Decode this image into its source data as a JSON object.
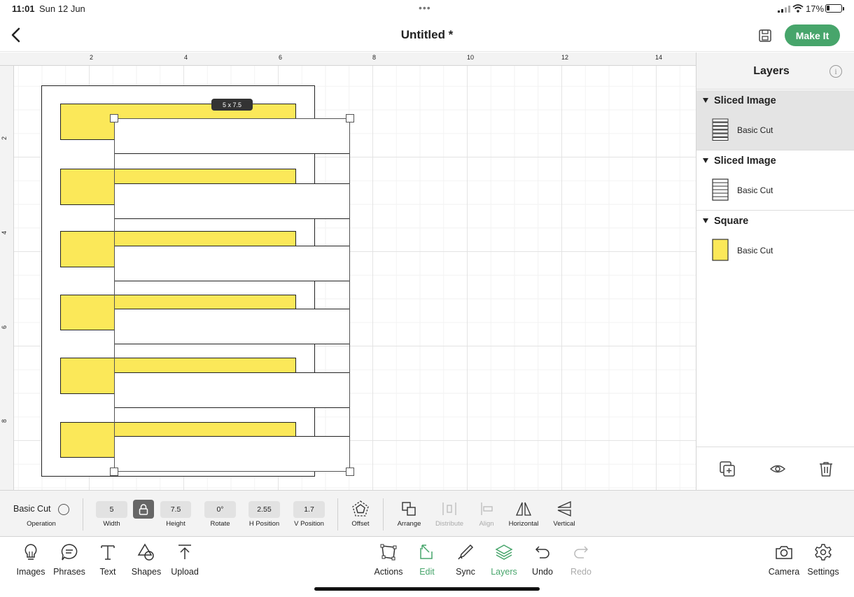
{
  "status_bar": {
    "time": "11:01",
    "date": "Sun 12 Jun",
    "battery": "17%"
  },
  "header": {
    "title": "Untitled *",
    "make_it": "Make It"
  },
  "canvas": {
    "ruler_top": [
      "2",
      "4",
      "6",
      "8",
      "10",
      "12",
      "14"
    ],
    "ruler_left": [
      "2",
      "4",
      "6",
      "8"
    ],
    "dimension_badge": "5 x 7.5"
  },
  "layers_panel": {
    "title": "Layers",
    "groups": [
      {
        "name": "Sliced Image",
        "item": "Basic Cut",
        "selected": true
      },
      {
        "name": "Sliced Image",
        "item": "Basic Cut",
        "selected": false
      },
      {
        "name": "Square",
        "item": "Basic Cut",
        "selected": false
      }
    ]
  },
  "edit_bar": {
    "operation_value": "Basic Cut",
    "operation_caption": "Operation",
    "width": {
      "value": "5",
      "caption": "Width"
    },
    "height": {
      "value": "7.5",
      "caption": "Height"
    },
    "rotate": {
      "value": "0°",
      "caption": "Rotate"
    },
    "h_position": {
      "value": "2.55",
      "caption": "H Position"
    },
    "v_position": {
      "value": "1.7",
      "caption": "V Position"
    },
    "offset": "Offset",
    "arrange": "Arrange",
    "distribute": "Distribute",
    "align": "Align",
    "horizontal": "Horizontal",
    "vertical": "Vertical"
  },
  "toolbar": {
    "left": [
      "Images",
      "Phrases",
      "Text",
      "Shapes",
      "Upload"
    ],
    "center": [
      "Actions",
      "Edit",
      "Sync",
      "Layers",
      "Undo",
      "Redo"
    ],
    "right": [
      "Camera",
      "Settings"
    ]
  },
  "colors": {
    "accent": "#47a56b",
    "shape_fill": "#fbe859",
    "canvas_bg": "#f3f3f3"
  }
}
